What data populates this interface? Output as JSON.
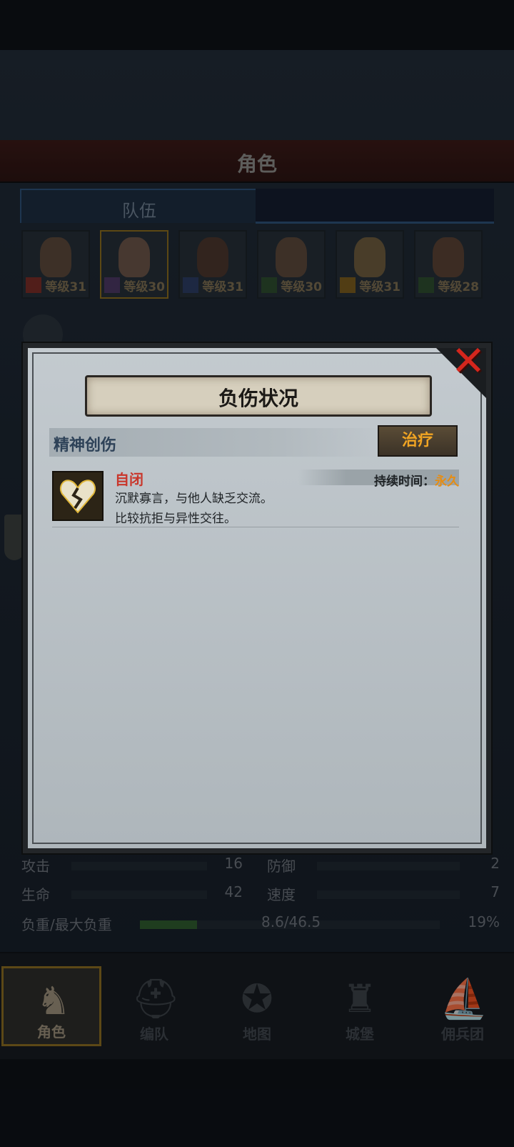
{
  "header": {
    "title": "角色"
  },
  "tabs": {
    "team": "队伍"
  },
  "roster": [
    {
      "level": "等级31"
    },
    {
      "level": "等级30"
    },
    {
      "level": "等级31"
    },
    {
      "level": "等级30"
    },
    {
      "level": "等级31"
    },
    {
      "level": "等级28"
    }
  ],
  "stats": {
    "attack_label": "攻击",
    "attack_value": "16",
    "defense_label": "防御",
    "defense_value": "2",
    "hp_label": "生命",
    "hp_value": "42",
    "speed_label": "速度",
    "speed_value": "7",
    "load_label": "负重/最大负重",
    "load_value": "8.6/46.5",
    "load_percent": "19%",
    "load_fraction": 0.19
  },
  "nav": {
    "character": "角色",
    "formation": "编队",
    "map": "地图",
    "castle": "城堡",
    "mercenary": "佣兵团"
  },
  "modal": {
    "title": "负伤状况",
    "section": "精神创伤",
    "heal_label": "治疗",
    "injury": {
      "name": "自闭",
      "desc1": "沉默寡言，与他人缺乏交流。",
      "desc2": "比较抗拒与异性交往。",
      "duration_label": "持续时间：",
      "duration_value": "永久"
    },
    "close_glyph": "✕"
  },
  "colors": {
    "accent_orange": "#f0a423",
    "injury_red": "#c9362b",
    "close_red": "#d4261d"
  }
}
